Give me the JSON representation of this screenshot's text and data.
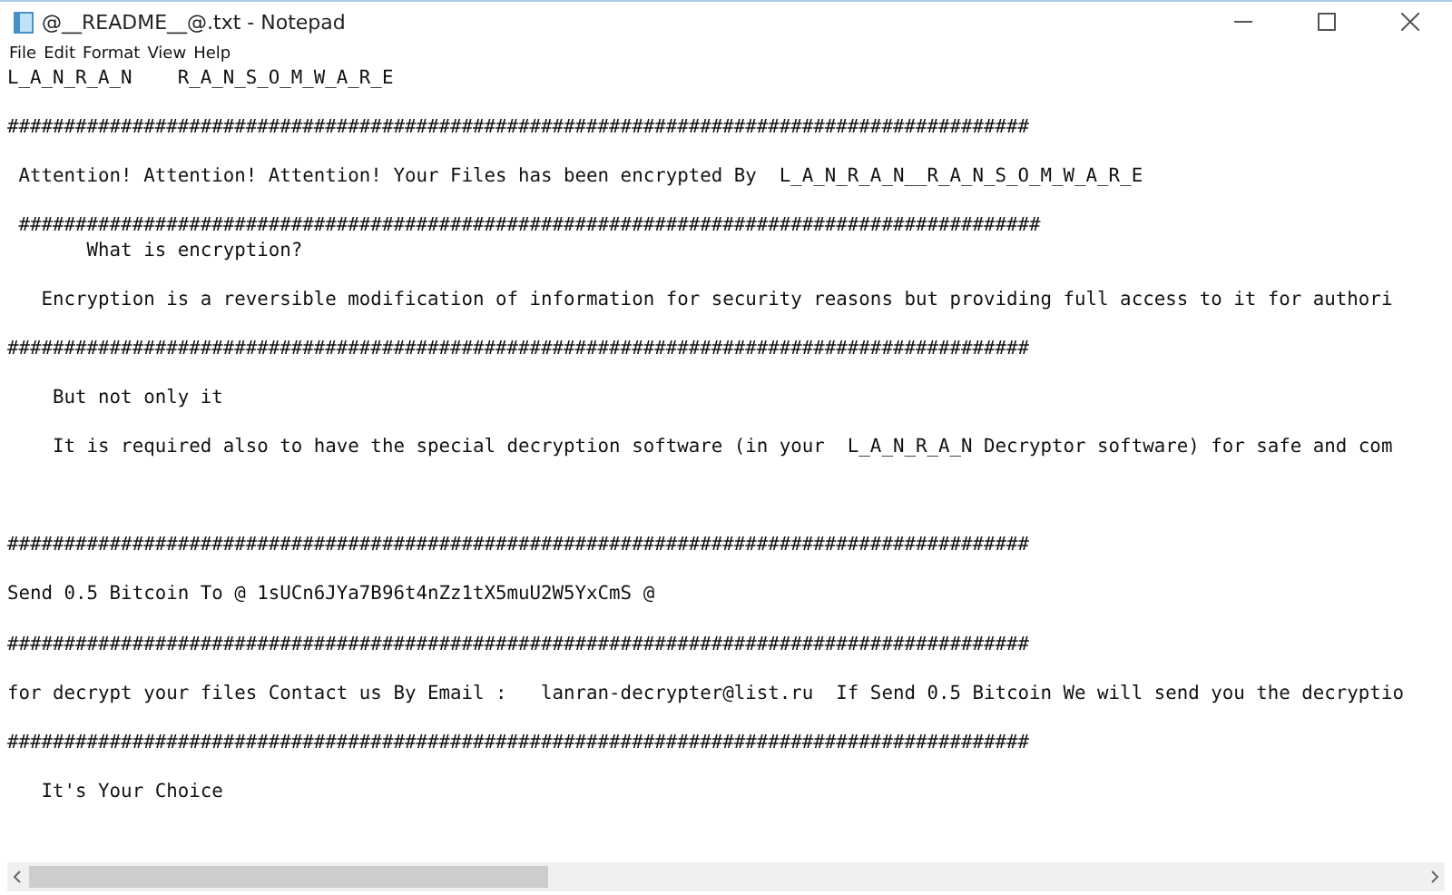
{
  "window": {
    "title": "@__README__@.txt - Notepad"
  },
  "menu": [
    "File",
    "Edit",
    "Format",
    "View",
    "Help"
  ],
  "lines": [
    "L_A_N_R_A_N    R_A_N_S_O_M_W_A_R_E",
    "##########################################################################################",
    " Attention! Attention! Attention! Your Files has been encrypted By  L_A_N_R_A_N__R_A_N_S_O_M_W_A_R_E",
    " ##########################################################################################",
    "       What is encryption?",
    "   Encryption is a reversible modification of information for security reasons but providing full access to it for authori",
    "##########################################################################################",
    "    But not only it",
    "    It is required also to have the special decryption software (in your  L_A_N_R_A_N Decryptor software) for safe and com",
    "##########################################################################################",
    "Send 0.5 Bitcoin To @ 1sUCn6JYa7B96t4nZz1tX5muU2W5YxCmS @",
    "##########################################################################################",
    "for decrypt your files Contact us By Email :   lanran-decrypter@list.ru  If Send 0.5 Bitcoin We will send you the decryptio",
    "##########################################################################################",
    "   It's Your Choice"
  ]
}
